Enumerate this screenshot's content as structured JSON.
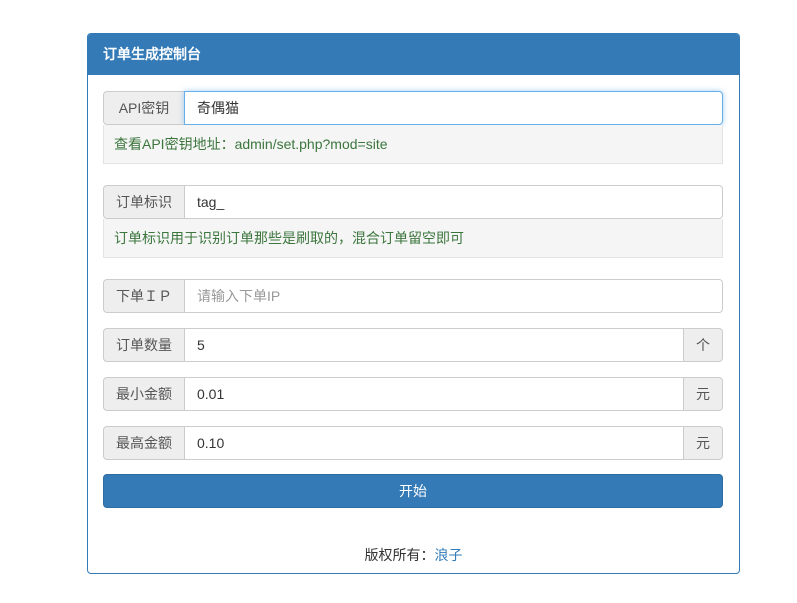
{
  "panel": {
    "title": "订单生成控制台"
  },
  "api_key": {
    "label": "API密钥",
    "value": "奇偶猫",
    "help": "查看API密钥地址：admin/set.php?mod=site"
  },
  "order_tag": {
    "label": "订单标识",
    "value": "tag_",
    "help": "订单标识用于识别订单那些是刷取的，混合订单留空即可"
  },
  "order_ip": {
    "label": "下单ＩＰ",
    "value": "",
    "placeholder": "请输入下单IP"
  },
  "order_count": {
    "label": "订单数量",
    "value": "5",
    "unit": "个"
  },
  "min_amount": {
    "label": "最小金额",
    "value": "0.01",
    "unit": "元"
  },
  "max_amount": {
    "label": "最高金额",
    "value": "0.10",
    "unit": "元"
  },
  "start_button": {
    "label": "开始"
  },
  "footer": {
    "copyright_label": "版权所有：",
    "author_link": "浪子"
  },
  "colors": {
    "primary": "#337ab7",
    "help_text": "#3c763d",
    "addon_bg": "#eeeeee"
  }
}
